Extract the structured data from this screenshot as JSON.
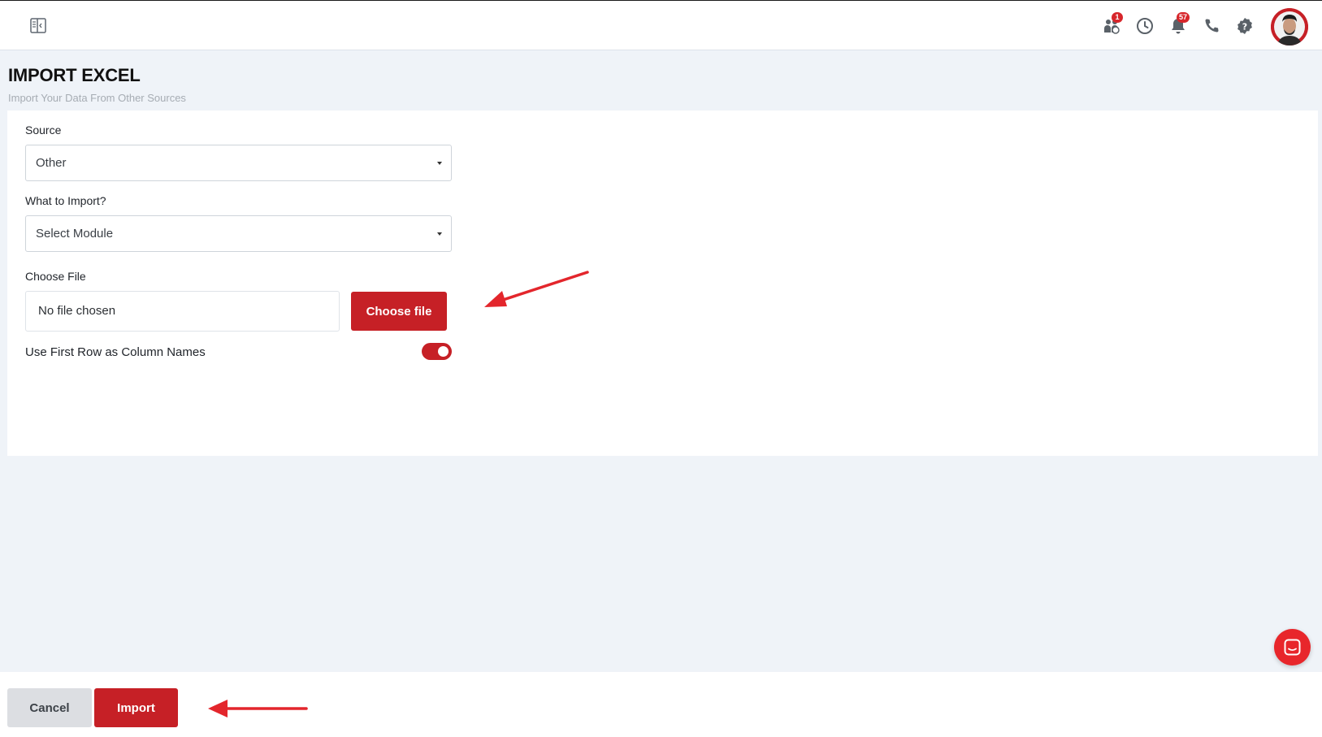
{
  "topbar": {
    "sidebar_toggle_icon": "sidebar-collapse-icon",
    "icons": [
      {
        "name": "team-icon",
        "badge": "1"
      },
      {
        "name": "clock-icon",
        "badge": ""
      },
      {
        "name": "bell-icon",
        "badge": "57"
      },
      {
        "name": "phone-icon",
        "badge": ""
      },
      {
        "name": "help-icon",
        "badge": ""
      }
    ],
    "avatar_icon": "user-avatar"
  },
  "page": {
    "title": "IMPORT EXCEL",
    "subtitle": "Import Your Data From Other Sources"
  },
  "form": {
    "source_label": "Source",
    "source_value": "Other",
    "module_label": "What to Import?",
    "module_value": "Select Module",
    "file_label": "Choose File",
    "file_status": "No file chosen",
    "choose_file_button": "Choose file",
    "first_row_label": "Use First Row as Column Names",
    "first_row_enabled": true
  },
  "footer": {
    "cancel_label": "Cancel",
    "import_label": "Import"
  },
  "chat_icon": "chat-icon",
  "colors": {
    "accent": "#c62026",
    "background": "#eff3f8",
    "annotation_arrow": "#e3262c"
  }
}
